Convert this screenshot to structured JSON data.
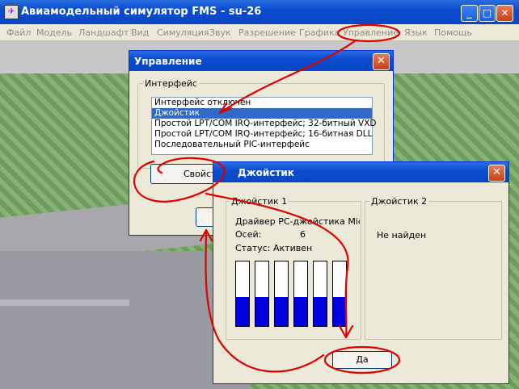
{
  "window": {
    "title": "Авиамодельный симулятор FMS - su-26",
    "icon": "app-icon",
    "controls": {
      "minimize": "_",
      "maximize": "□",
      "close": "✕"
    }
  },
  "menu": [
    "Файл",
    "Модель",
    "Ландшафт",
    "Вид",
    "Симуляция",
    "Звук",
    "Разрешение",
    "Графика",
    "Управление",
    "Язык",
    "Помощь"
  ],
  "control_dialog": {
    "title": "Управление",
    "close": "✕",
    "group_label": "Интерфейс",
    "options": [
      "Интерфейс отключен",
      "Джойстик",
      "Простой LPT/COM IRQ-интерфейс; 32-битный VXD",
      "Простой LPT/COM IRQ-интерфейс; 16-битная DLL",
      "Последовательный PIC-интерфейс"
    ],
    "selected_index": 1,
    "properties_button": "Свойства"
  },
  "joystick_dialog": {
    "title": "Джойстик",
    "close": "✕",
    "joystick1": {
      "label": "Джойстик 1",
      "driver": "Драйвер PC-джойстика Micros",
      "axes_label": "Осей:",
      "axes_value": "6",
      "status": "Статус: Активен",
      "axis_levels": [
        0.45,
        0.45,
        0.45,
        0.45,
        0.45,
        0.45
      ]
    },
    "joystick2": {
      "label": "Джойстик 2",
      "status": "Не найден"
    },
    "ok_button": "Да"
  },
  "colors": {
    "titlebar": "#0a4cd0",
    "annotation": "#e00000",
    "axis_fill": "#0000e0",
    "selection": "#316ac5"
  }
}
